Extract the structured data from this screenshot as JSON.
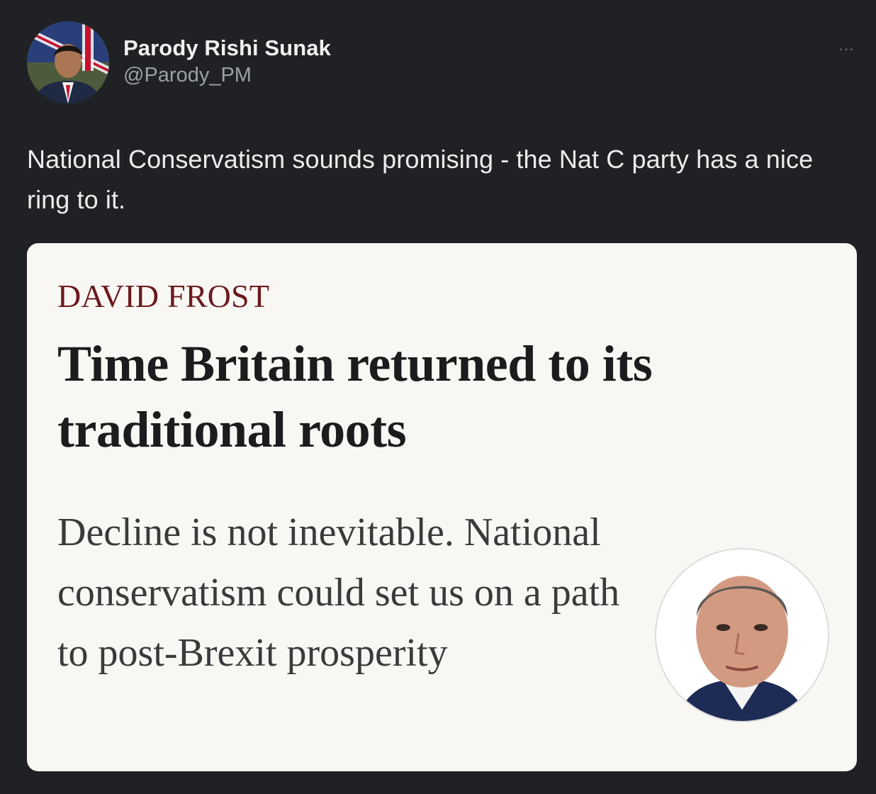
{
  "tweet": {
    "display_name": "Parody Rishi Sunak",
    "handle": "@Parody_PM",
    "more_icon": "ellipsis-icon",
    "more_label": "···",
    "text": "National Conservatism sounds promising - the Nat C party has a nice ring to it."
  },
  "card": {
    "author": "DAVID FROST",
    "headline": "Time Britain returned to its traditional roots",
    "standfirst": "Decline is not inevitable. National conservatism could set us on a path to post-Brexit prosperity"
  },
  "colors": {
    "background": "#202124",
    "card_background": "#f9f7f4",
    "author_color": "#6b1a1f",
    "handle_color": "#9aa0a6"
  }
}
